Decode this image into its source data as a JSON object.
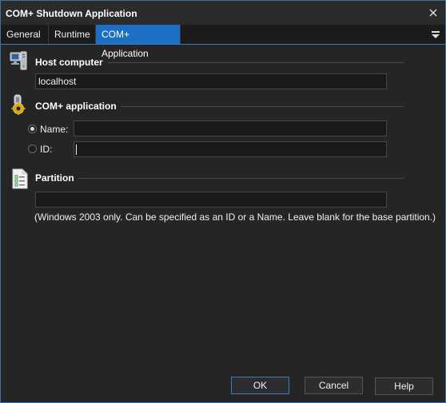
{
  "window": {
    "title": "COM+ Shutdown Application"
  },
  "tabs": [
    {
      "label": "General",
      "active": false
    },
    {
      "label": "Runtime",
      "active": false
    },
    {
      "label": "COM+ Application",
      "active": true
    }
  ],
  "host": {
    "title": "Host computer",
    "value": "localhost",
    "icon": "computer-icon"
  },
  "application": {
    "title": "COM+ application",
    "icon": "gear-icon",
    "name_label": "Name:",
    "id_label": "ID:",
    "name_value": "",
    "id_value": "",
    "selected": "name"
  },
  "partition": {
    "title": "Partition",
    "icon": "document-icon",
    "value": "",
    "hint": "(Windows 2003 only. Can be specified as an ID or a  Name. Leave blank for the base partition.)"
  },
  "buttons": {
    "ok": "OK",
    "cancel": "Cancel",
    "help": "Help"
  },
  "colors": {
    "accent": "#1c6fc4",
    "background": "#252526",
    "field": "#1a1a1a"
  }
}
